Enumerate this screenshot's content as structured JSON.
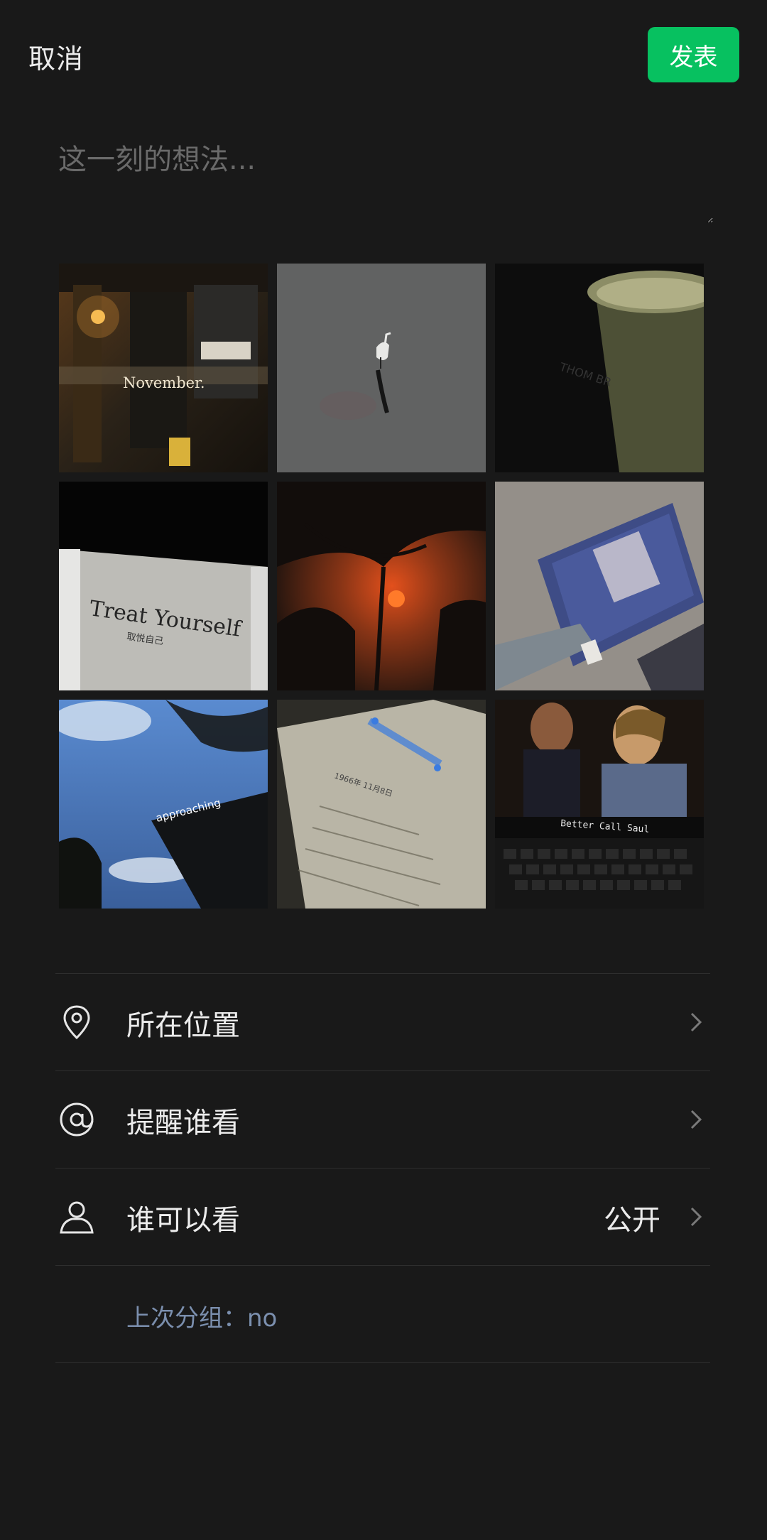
{
  "header": {
    "cancel_label": "取消",
    "publish_label": "发表"
  },
  "composer": {
    "placeholder": "这一刻的想法..."
  },
  "photos": [
    {
      "caption": "November."
    },
    {
      "caption": ""
    },
    {
      "caption": "THOM BR"
    },
    {
      "caption": "Treat Yourself",
      "sub": "取悦自己"
    },
    {
      "caption": ""
    },
    {
      "caption": ""
    },
    {
      "caption": "approaching"
    },
    {
      "caption": "1966年 11月8日"
    },
    {
      "caption": "Better Call Saul"
    }
  ],
  "options": {
    "location": {
      "label": "所在位置",
      "icon": "location-pin-icon"
    },
    "mention": {
      "label": "提醒谁看",
      "icon": "at-icon"
    },
    "visibility": {
      "label": "谁可以看",
      "value": "公开",
      "icon": "person-icon"
    }
  },
  "last_group": "上次分组：no",
  "colors": {
    "background": "#191919",
    "accent": "#07c160",
    "last_group_text": "#7b8fae"
  }
}
